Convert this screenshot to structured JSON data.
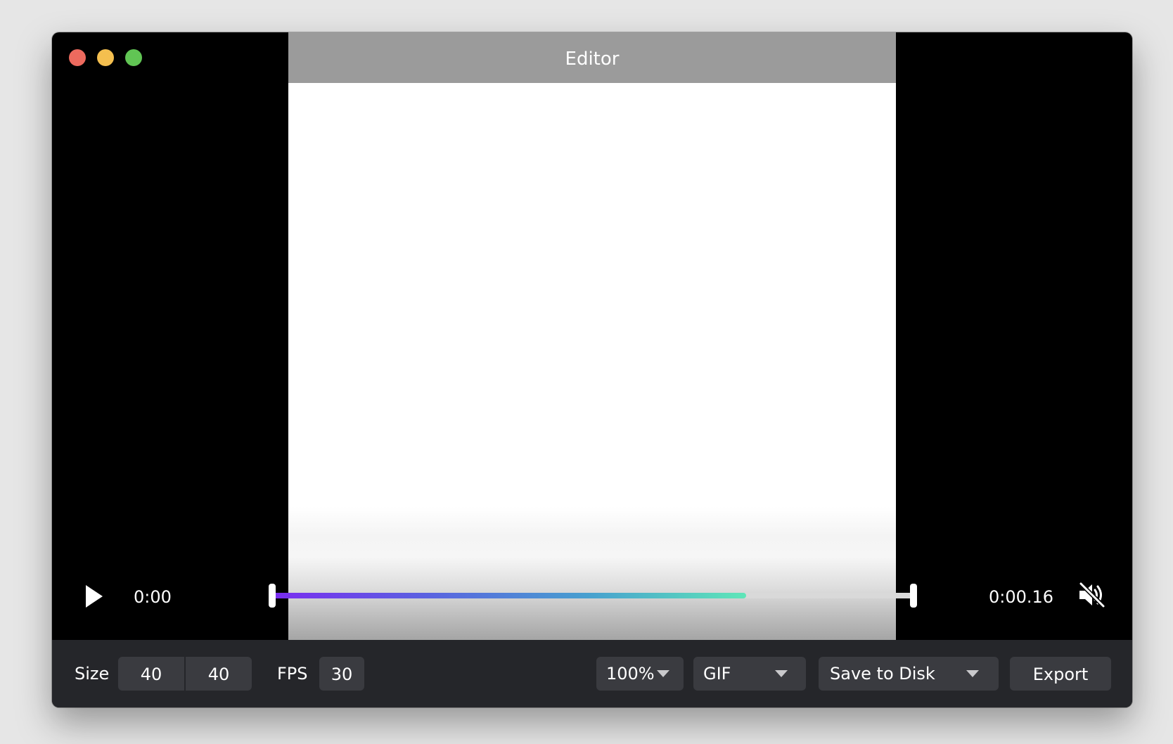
{
  "window": {
    "traffic_lights": [
      {
        "name": "close",
        "color": "#ed6a5e"
      },
      {
        "name": "minimize",
        "color": "#f4bf4f"
      },
      {
        "name": "zoom",
        "color": "#61c554"
      }
    ]
  },
  "preview": {
    "title": "Editor"
  },
  "player": {
    "play_icon": "play-icon",
    "current_time": "0:00",
    "end_time": "0:00.16",
    "progress_fraction": 0.74,
    "gradient_colors": [
      "#7a2cf0",
      "#5a63e0",
      "#47a0cf",
      "#5fe6b8"
    ],
    "mute_icon": "speaker-muted-icon"
  },
  "toolbar": {
    "size_label": "Size",
    "width_value": "40",
    "height_value": "40",
    "fps_label": "FPS",
    "fps_value": "30",
    "zoom_value": "100%",
    "format_value": "GIF",
    "destination_value": "Save to Disk",
    "export_label": "Export"
  }
}
